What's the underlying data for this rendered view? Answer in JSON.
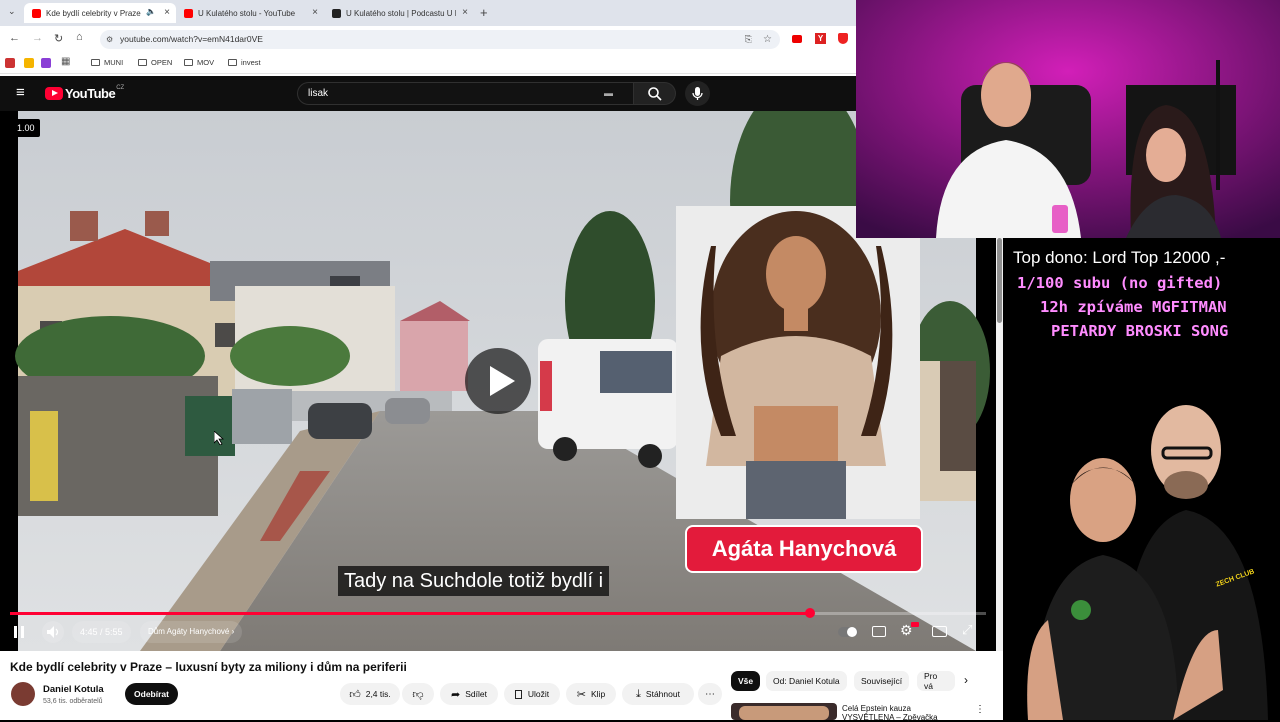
{
  "browser": {
    "tabs": [
      {
        "label": "Kde bydlí celebrity v Praze",
        "active": true
      },
      {
        "label": "U Kulatého stolu - YouTube",
        "active": false
      },
      {
        "label": "U Kulatého stolu | Podcastu U Ku",
        "active": false
      }
    ],
    "new_tab": "+",
    "url": "youtube.com/watch?v=emN41dar0VE",
    "bookmarks": [
      "MUNI",
      "OPEN",
      "MOV",
      "invest"
    ]
  },
  "youtube": {
    "logo_text": "YouTube",
    "region": "CZ",
    "search_value": "lisak",
    "playback_speed": "1.00",
    "subtitle": "Tady na Suchdole totiž bydlí i",
    "name_card": "Agáta Hanychová",
    "time": "4:45 / 5:55",
    "chapter": "Dům Agáty Hanychové",
    "progress": 0.82,
    "title": "Kde bydlí celebrity v Praze – luxusní byty za miliony i dům na periferii",
    "channel": {
      "name": "Daniel Kotula",
      "subscribers": "53,6 tis. odběratelů"
    },
    "subscribe_label": "Odebírat",
    "likes": "2,4 tis.",
    "share_label": "Sdílet",
    "save_label": "Uložit",
    "clip_label": "Klip",
    "download_label": "Stáhnout",
    "chips": [
      "Vše",
      "Od: Daniel Kotula",
      "Související",
      "Pro vá"
    ],
    "related_title_1": "Celá Epstein kauza",
    "related_title_2": "VYSVĚTLENA – Zpěvačka"
  },
  "stream_overlay": {
    "line1": "Top dono: Lord Top 12000 ,-",
    "line2": "1/100 subu (no gifted)",
    "line3": "12h zpíváme MGFITMAN",
    "line4": "PETARDY BROSKI SONG",
    "shirt_text": "ZECH CLUB"
  },
  "colors": {
    "accent_red": "#ff0033",
    "overlay_text": "#ff8cff",
    "name_card_bg": "#e31b3b"
  }
}
